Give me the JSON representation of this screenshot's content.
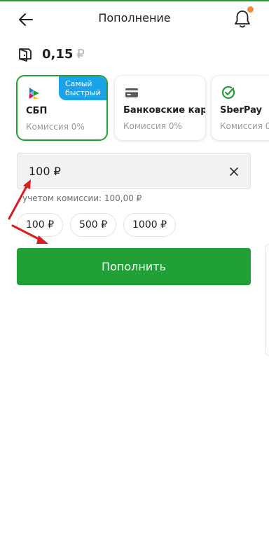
{
  "header": {
    "title": "Пополнение"
  },
  "balance": {
    "amount": "0,15",
    "currency": "₽"
  },
  "methods": [
    {
      "name": "СБП",
      "fee": "Комиссия 0%",
      "badge": "Самый быстрый",
      "selected": true,
      "icon": "sbp-icon"
    },
    {
      "name": "Банковские кар",
      "fee": "Комиссия 0%",
      "selected": false,
      "icon": "card-icon"
    },
    {
      "name": "SberPay",
      "fee": "Комиссия 0",
      "selected": false,
      "icon": "sberpay-icon"
    }
  ],
  "amount_input": {
    "value": "100 ₽"
  },
  "fee_note": "учетом комиссии: 100,00 ₽",
  "quick_amounts": [
    "100 ₽",
    "500 ₽",
    "1000 ₽"
  ],
  "submit_label": "Пополнить",
  "colors": {
    "accent": "#21a038",
    "badge": "#1aa3ea",
    "notification_dot": "#f28b3a",
    "annotation_arrow": "#d81e1e"
  }
}
